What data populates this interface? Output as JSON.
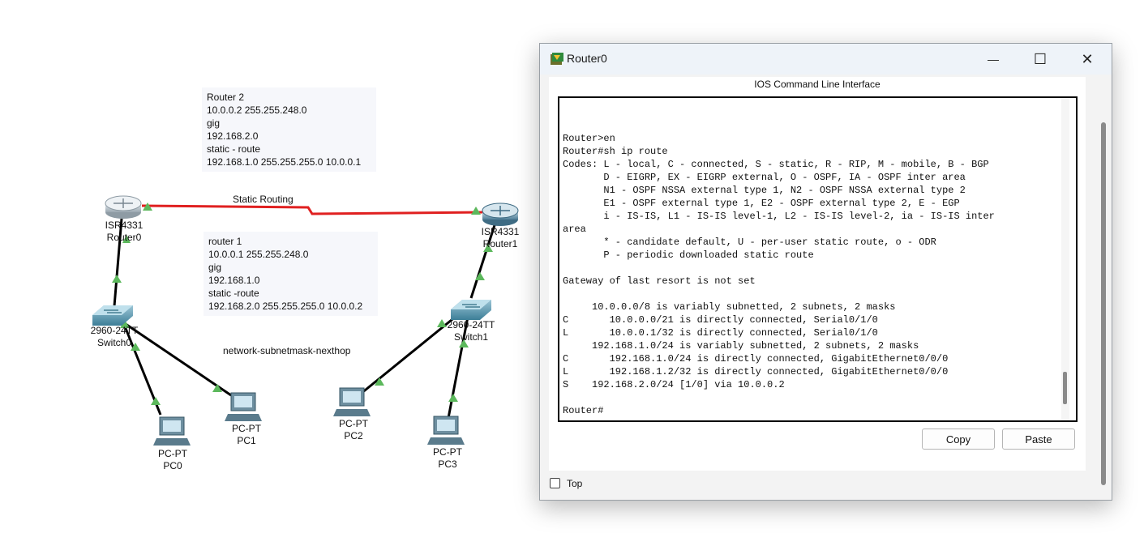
{
  "topology": {
    "notes": [
      {
        "name": "note-router2",
        "lines": [
          "Router 2",
          "10.0.0.2 255.255.248.0",
          "gig",
          "192.168.2.0",
          "static - route",
          "192.168.1.0 255.255.255.0 10.0.0.1"
        ]
      },
      {
        "name": "note-router1",
        "lines": [
          "router 1",
          "10.0.0.1 255.255.248.0",
          "gig",
          "192.168.1.0",
          "static -route",
          "192.168.2.0 255.255.255.0 10.0.0.2"
        ]
      }
    ],
    "link_label": "Static Routing",
    "caption": "network-subnetmask-nexthop",
    "devices": {
      "router0": {
        "model": "ISR4331",
        "name": "Router0"
      },
      "router1": {
        "model": "ISR4331",
        "name": "Router1"
      },
      "switch0": {
        "model": "2960-24TT",
        "name": "Switch0"
      },
      "switch1": {
        "model": "2960-24TT",
        "name": "Switch1"
      },
      "pc0": {
        "model": "PC-PT",
        "name": "PC0"
      },
      "pc1": {
        "model": "PC-PT",
        "name": "PC1"
      },
      "pc2": {
        "model": "PC-PT",
        "name": "PC2"
      },
      "pc3": {
        "model": "PC-PT",
        "name": "PC3"
      }
    },
    "colors": {
      "serial_link": "#e02020",
      "ethernet_link": "#000000",
      "link_up": "#5cb85c"
    }
  },
  "window": {
    "title": "Router0",
    "controls": {
      "minimize": "—",
      "maximize": "☐",
      "close": "✕"
    },
    "heading": "IOS Command Line Interface",
    "terminal_lines": [
      "Router>en",
      "Router#sh ip route",
      "Codes: L - local, C - connected, S - static, R - RIP, M - mobile, B - BGP",
      "       D - EIGRP, EX - EIGRP external, O - OSPF, IA - OSPF inter area",
      "       N1 - OSPF NSSA external type 1, N2 - OSPF NSSA external type 2",
      "       E1 - OSPF external type 1, E2 - OSPF external type 2, E - EGP",
      "       i - IS-IS, L1 - IS-IS level-1, L2 - IS-IS level-2, ia - IS-IS inter",
      "area",
      "       * - candidate default, U - per-user static route, o - ODR",
      "       P - periodic downloaded static route",
      "",
      "Gateway of last resort is not set",
      "",
      "     10.0.0.0/8 is variably subnetted, 2 subnets, 2 masks",
      "C       10.0.0.0/21 is directly connected, Serial0/1/0",
      "L       10.0.0.1/32 is directly connected, Serial0/1/0",
      "     192.168.1.0/24 is variably subnetted, 2 subnets, 2 masks",
      "C       192.168.1.0/24 is directly connected, GigabitEthernet0/0/0",
      "L       192.168.1.2/32 is directly connected, GigabitEthernet0/0/0",
      "S    192.168.2.0/24 [1/0] via 10.0.0.2",
      "",
      "Router#"
    ],
    "buttons": {
      "copy": "Copy",
      "paste": "Paste"
    },
    "top_checkbox": {
      "label": "Top",
      "checked": false
    }
  }
}
